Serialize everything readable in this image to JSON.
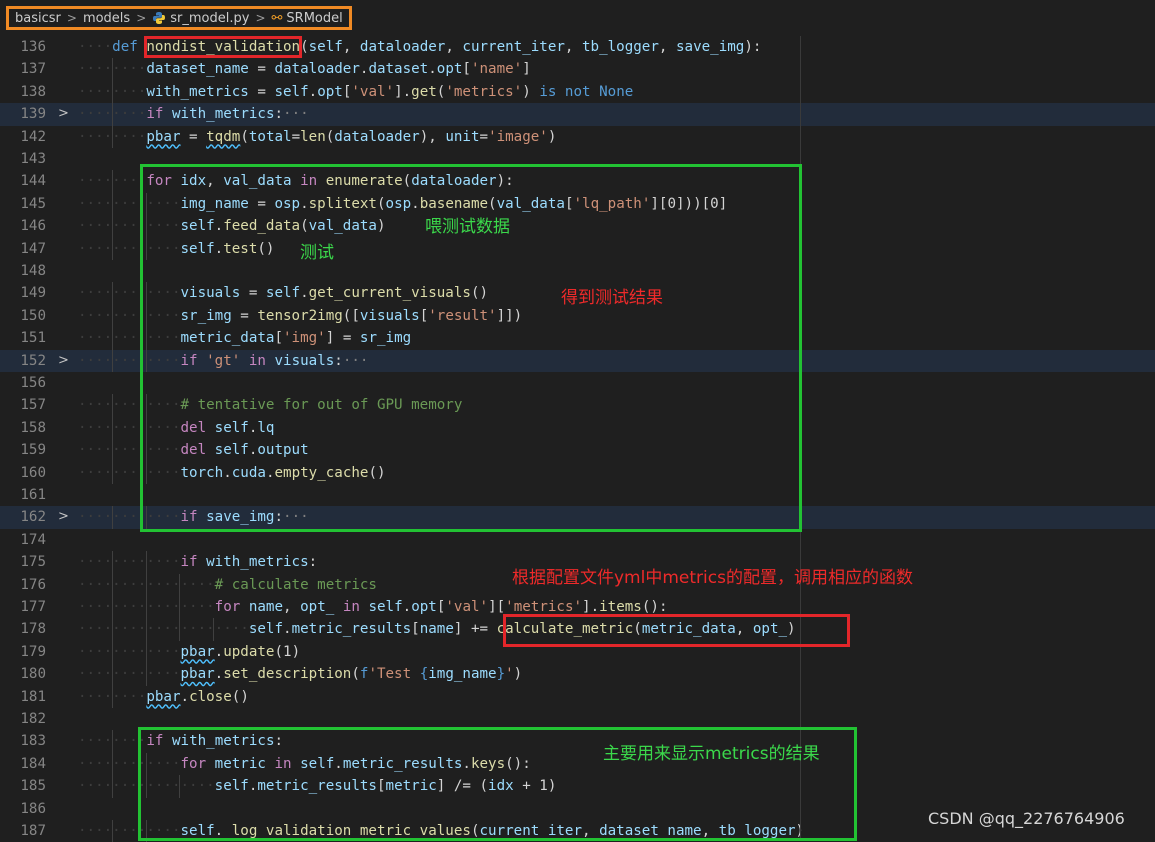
{
  "breadcrumb": {
    "items": [
      "basicsr",
      "models",
      "sr_model.py",
      "SRModel"
    ],
    "separator": ">"
  },
  "lines": [
    {
      "n": "136",
      "fold": false,
      "hl": false
    },
    {
      "n": "137",
      "fold": false,
      "hl": false
    },
    {
      "n": "138",
      "fold": false,
      "hl": false
    },
    {
      "n": "139",
      "fold": true,
      "hl": true
    },
    {
      "n": "142",
      "fold": false,
      "hl": false
    },
    {
      "n": "143",
      "fold": false,
      "hl": false
    },
    {
      "n": "144",
      "fold": false,
      "hl": false
    },
    {
      "n": "145",
      "fold": false,
      "hl": false
    },
    {
      "n": "146",
      "fold": false,
      "hl": false
    },
    {
      "n": "147",
      "fold": false,
      "hl": false
    },
    {
      "n": "148",
      "fold": false,
      "hl": false
    },
    {
      "n": "149",
      "fold": false,
      "hl": false
    },
    {
      "n": "150",
      "fold": false,
      "hl": false
    },
    {
      "n": "151",
      "fold": false,
      "hl": false
    },
    {
      "n": "152",
      "fold": true,
      "hl": true
    },
    {
      "n": "156",
      "fold": false,
      "hl": false
    },
    {
      "n": "157",
      "fold": false,
      "hl": false
    },
    {
      "n": "158",
      "fold": false,
      "hl": false
    },
    {
      "n": "159",
      "fold": false,
      "hl": false
    },
    {
      "n": "160",
      "fold": false,
      "hl": false
    },
    {
      "n": "161",
      "fold": false,
      "hl": false
    },
    {
      "n": "162",
      "fold": true,
      "hl": true
    },
    {
      "n": "174",
      "fold": false,
      "hl": false
    },
    {
      "n": "175",
      "fold": false,
      "hl": false
    },
    {
      "n": "176",
      "fold": false,
      "hl": false
    },
    {
      "n": "177",
      "fold": false,
      "hl": false
    },
    {
      "n": "178",
      "fold": false,
      "hl": false
    },
    {
      "n": "179",
      "fold": false,
      "hl": false
    },
    {
      "n": "180",
      "fold": false,
      "hl": false
    },
    {
      "n": "181",
      "fold": false,
      "hl": false
    },
    {
      "n": "182",
      "fold": false,
      "hl": false
    },
    {
      "n": "183",
      "fold": false,
      "hl": false
    },
    {
      "n": "184",
      "fold": false,
      "hl": false
    },
    {
      "n": "185",
      "fold": false,
      "hl": false
    },
    {
      "n": "186",
      "fold": false,
      "hl": false
    },
    {
      "n": "187",
      "fold": false,
      "hl": false
    }
  ],
  "code": [
    [
      [
        1,
        ""
      ],
      [
        "kw",
        "def"
      ],
      [
        "txt",
        " "
      ],
      [
        "fn",
        "nondist_validation"
      ],
      [
        "txt",
        "("
      ],
      [
        "var",
        "self"
      ],
      [
        "txt",
        ", "
      ],
      [
        "var",
        "dataloader"
      ],
      [
        "txt",
        ", "
      ],
      [
        "var",
        "current_iter"
      ],
      [
        "txt",
        ", "
      ],
      [
        "var",
        "tb_logger"
      ],
      [
        "txt",
        ", "
      ],
      [
        "var",
        "save_img"
      ],
      [
        "txt",
        "):"
      ]
    ],
    [
      [
        2,
        ""
      ],
      [
        "var",
        "dataset_name"
      ],
      [
        "txt",
        " = "
      ],
      [
        "var",
        "dataloader"
      ],
      [
        "txt",
        "."
      ],
      [
        "var",
        "dataset"
      ],
      [
        "txt",
        "."
      ],
      [
        "var",
        "opt"
      ],
      [
        "txt",
        "["
      ],
      [
        "str",
        "'name'"
      ],
      [
        "txt",
        "]"
      ]
    ],
    [
      [
        2,
        ""
      ],
      [
        "var",
        "with_metrics"
      ],
      [
        "txt",
        " = "
      ],
      [
        "var",
        "self"
      ],
      [
        "txt",
        "."
      ],
      [
        "var",
        "opt"
      ],
      [
        "txt",
        "["
      ],
      [
        "str",
        "'val'"
      ],
      [
        "txt",
        "]."
      ],
      [
        "fn",
        "get"
      ],
      [
        "txt",
        "("
      ],
      [
        "str",
        "'metrics'"
      ],
      [
        "txt",
        ") "
      ],
      [
        "kw",
        "is not"
      ],
      [
        "txt",
        " "
      ],
      [
        "kw",
        "None"
      ]
    ],
    [
      [
        2,
        ""
      ],
      [
        "kc",
        "if"
      ],
      [
        "txt",
        " "
      ],
      [
        "var",
        "with_metrics"
      ],
      [
        "txt",
        ":"
      ],
      [
        "fold-ell",
        "···"
      ]
    ],
    [
      [
        2,
        ""
      ],
      [
        "var squig",
        "pbar"
      ],
      [
        "txt",
        " = "
      ],
      [
        "fn squig",
        "tqdm"
      ],
      [
        "txt",
        "("
      ],
      [
        "var",
        "total"
      ],
      [
        "txt",
        "="
      ],
      [
        "fn",
        "len"
      ],
      [
        "txt",
        "("
      ],
      [
        "var",
        "dataloader"
      ],
      [
        "txt",
        "), "
      ],
      [
        "var",
        "unit"
      ],
      [
        "txt",
        "="
      ],
      [
        "str",
        "'image'"
      ],
      [
        "txt",
        ")"
      ]
    ],
    [
      [
        0,
        ""
      ]
    ],
    [
      [
        2,
        ""
      ],
      [
        "kc",
        "for"
      ],
      [
        "txt",
        " "
      ],
      [
        "var",
        "idx"
      ],
      [
        "txt",
        ", "
      ],
      [
        "var",
        "val_data"
      ],
      [
        "txt",
        " "
      ],
      [
        "kc",
        "in"
      ],
      [
        "txt",
        " "
      ],
      [
        "fn",
        "enumerate"
      ],
      [
        "txt",
        "("
      ],
      [
        "var",
        "dataloader"
      ],
      [
        "txt",
        "):"
      ]
    ],
    [
      [
        3,
        ""
      ],
      [
        "var",
        "img_name"
      ],
      [
        "txt",
        " = "
      ],
      [
        "var",
        "osp"
      ],
      [
        "txt",
        "."
      ],
      [
        "fn",
        "splitext"
      ],
      [
        "txt",
        "("
      ],
      [
        "var",
        "osp"
      ],
      [
        "txt",
        "."
      ],
      [
        "fn",
        "basename"
      ],
      [
        "txt",
        "("
      ],
      [
        "var",
        "val_data"
      ],
      [
        "txt",
        "["
      ],
      [
        "str",
        "'lq_path'"
      ],
      [
        "txt",
        "]["
      ],
      [
        "txt",
        "0"
      ],
      [
        "txt",
        "]))["
      ],
      [
        "txt",
        "0"
      ],
      [
        "txt",
        "]"
      ]
    ],
    [
      [
        3,
        ""
      ],
      [
        "var",
        "self"
      ],
      [
        "txt",
        "."
      ],
      [
        "fn",
        "feed_data"
      ],
      [
        "txt",
        "("
      ],
      [
        "var",
        "val_data"
      ],
      [
        "txt",
        ")"
      ]
    ],
    [
      [
        3,
        ""
      ],
      [
        "var",
        "self"
      ],
      [
        "txt",
        "."
      ],
      [
        "fn",
        "test"
      ],
      [
        "txt",
        "()"
      ]
    ],
    [
      [
        0,
        ""
      ]
    ],
    [
      [
        3,
        ""
      ],
      [
        "var",
        "visuals"
      ],
      [
        "txt",
        " = "
      ],
      [
        "var",
        "self"
      ],
      [
        "txt",
        "."
      ],
      [
        "fn",
        "get_current_visuals"
      ],
      [
        "txt",
        "()"
      ]
    ],
    [
      [
        3,
        ""
      ],
      [
        "var",
        "sr_img"
      ],
      [
        "txt",
        " = "
      ],
      [
        "fn",
        "tensor2img"
      ],
      [
        "txt",
        "(["
      ],
      [
        "var",
        "visuals"
      ],
      [
        "txt",
        "["
      ],
      [
        "str",
        "'result'"
      ],
      [
        "txt",
        "]])"
      ]
    ],
    [
      [
        3,
        ""
      ],
      [
        "var",
        "metric_data"
      ],
      [
        "txt",
        "["
      ],
      [
        "str",
        "'img'"
      ],
      [
        "txt",
        "] = "
      ],
      [
        "var",
        "sr_img"
      ]
    ],
    [
      [
        3,
        ""
      ],
      [
        "kc",
        "if"
      ],
      [
        "txt",
        " "
      ],
      [
        "str",
        "'gt'"
      ],
      [
        "txt",
        " "
      ],
      [
        "kc",
        "in"
      ],
      [
        "txt",
        " "
      ],
      [
        "var",
        "visuals"
      ],
      [
        "txt",
        ":"
      ],
      [
        "fold-ell",
        "···"
      ]
    ],
    [
      [
        0,
        ""
      ]
    ],
    [
      [
        3,
        ""
      ],
      [
        "cm",
        "# tentative for out of GPU memory"
      ]
    ],
    [
      [
        3,
        ""
      ],
      [
        "kc",
        "del"
      ],
      [
        "txt",
        " "
      ],
      [
        "var",
        "self"
      ],
      [
        "txt",
        "."
      ],
      [
        "var",
        "lq"
      ]
    ],
    [
      [
        3,
        ""
      ],
      [
        "kc",
        "del"
      ],
      [
        "txt",
        " "
      ],
      [
        "var",
        "self"
      ],
      [
        "txt",
        "."
      ],
      [
        "var",
        "output"
      ]
    ],
    [
      [
        3,
        ""
      ],
      [
        "var",
        "torch"
      ],
      [
        "txt",
        "."
      ],
      [
        "var",
        "cuda"
      ],
      [
        "txt",
        "."
      ],
      [
        "fn",
        "empty_cache"
      ],
      [
        "txt",
        "()"
      ]
    ],
    [
      [
        0,
        ""
      ]
    ],
    [
      [
        3,
        ""
      ],
      [
        "kc",
        "if"
      ],
      [
        "txt",
        " "
      ],
      [
        "var",
        "save_img"
      ],
      [
        "txt",
        ":"
      ],
      [
        "fold-ell",
        "···"
      ]
    ],
    [
      [
        0,
        ""
      ]
    ],
    [
      [
        3,
        ""
      ],
      [
        "kc",
        "if"
      ],
      [
        "txt",
        " "
      ],
      [
        "var",
        "with_metrics"
      ],
      [
        "txt",
        ":"
      ]
    ],
    [
      [
        4,
        ""
      ],
      [
        "cm",
        "# calculate metrics"
      ]
    ],
    [
      [
        4,
        ""
      ],
      [
        "kc",
        "for"
      ],
      [
        "txt",
        " "
      ],
      [
        "var",
        "name"
      ],
      [
        "txt",
        ", "
      ],
      [
        "var",
        "opt_"
      ],
      [
        "txt",
        " "
      ],
      [
        "kc",
        "in"
      ],
      [
        "txt",
        " "
      ],
      [
        "var",
        "self"
      ],
      [
        "txt",
        "."
      ],
      [
        "var",
        "opt"
      ],
      [
        "txt",
        "["
      ],
      [
        "str",
        "'val'"
      ],
      [
        "txt",
        "]["
      ],
      [
        "str",
        "'metrics'"
      ],
      [
        "txt",
        "]."
      ],
      [
        "fn",
        "items"
      ],
      [
        "txt",
        "():"
      ]
    ],
    [
      [
        5,
        ""
      ],
      [
        "var",
        "self"
      ],
      [
        "txt",
        "."
      ],
      [
        "var",
        "metric_results"
      ],
      [
        "txt",
        "["
      ],
      [
        "var",
        "name"
      ],
      [
        "txt",
        "] += "
      ],
      [
        "fn",
        "calculate_metric"
      ],
      [
        "txt",
        "("
      ],
      [
        "var",
        "metric_data"
      ],
      [
        "txt",
        ", "
      ],
      [
        "var",
        "opt_"
      ],
      [
        "txt",
        ")"
      ]
    ],
    [
      [
        3,
        ""
      ],
      [
        "var squig",
        "pbar"
      ],
      [
        "txt",
        "."
      ],
      [
        "fn",
        "update"
      ],
      [
        "txt",
        "("
      ],
      [
        "txt",
        "1"
      ],
      [
        "txt",
        ")"
      ]
    ],
    [
      [
        3,
        ""
      ],
      [
        "var squig",
        "pbar"
      ],
      [
        "txt",
        "."
      ],
      [
        "fn",
        "set_description"
      ],
      [
        "txt",
        "("
      ],
      [
        "kw",
        "f"
      ],
      [
        "str",
        "'Test "
      ],
      [
        "kw",
        "{"
      ],
      [
        "var",
        "img_name"
      ],
      [
        "kw",
        "}"
      ],
      [
        "str",
        "'"
      ],
      [
        "txt",
        ")"
      ]
    ],
    [
      [
        2,
        ""
      ],
      [
        "var squig",
        "pbar"
      ],
      [
        "txt",
        "."
      ],
      [
        "fn",
        "close"
      ],
      [
        "txt",
        "()"
      ]
    ],
    [
      [
        0,
        ""
      ]
    ],
    [
      [
        2,
        ""
      ],
      [
        "kc",
        "if"
      ],
      [
        "txt",
        " "
      ],
      [
        "var",
        "with_metrics"
      ],
      [
        "txt",
        ":"
      ]
    ],
    [
      [
        3,
        ""
      ],
      [
        "kc",
        "for"
      ],
      [
        "txt",
        " "
      ],
      [
        "var",
        "metric"
      ],
      [
        "txt",
        " "
      ],
      [
        "kc",
        "in"
      ],
      [
        "txt",
        " "
      ],
      [
        "var",
        "self"
      ],
      [
        "txt",
        "."
      ],
      [
        "var",
        "metric_results"
      ],
      [
        "txt",
        "."
      ],
      [
        "fn",
        "keys"
      ],
      [
        "txt",
        "():"
      ]
    ],
    [
      [
        4,
        ""
      ],
      [
        "var",
        "self"
      ],
      [
        "txt",
        "."
      ],
      [
        "var",
        "metric_results"
      ],
      [
        "txt",
        "["
      ],
      [
        "var",
        "metric"
      ],
      [
        "txt",
        "] /= ("
      ],
      [
        "var",
        "idx"
      ],
      [
        "txt",
        " + "
      ],
      [
        "txt",
        "1"
      ],
      [
        "txt",
        ")"
      ]
    ],
    [
      [
        0,
        ""
      ]
    ],
    [
      [
        3,
        ""
      ],
      [
        "var",
        "self"
      ],
      [
        "txt",
        "."
      ],
      [
        "fn",
        "_log_validation_metric_values"
      ],
      [
        "txt",
        "("
      ],
      [
        "var",
        "current_iter"
      ],
      [
        "txt",
        ", "
      ],
      [
        "var",
        "dataset_name"
      ],
      [
        "txt",
        ", "
      ],
      [
        "var",
        "tb_logger"
      ],
      [
        "txt",
        ")"
      ]
    ]
  ],
  "annotations": {
    "feed": "喂测试数据",
    "test": "测试",
    "result": "得到测试结果",
    "config": "根据配置文件yml中metrics的配置，调用相应的函数",
    "display": "主要用来显示metrics的结果"
  },
  "watermark": "CSDN @qq_2276764906",
  "colors": {
    "background": "#1f1f1f",
    "red_box": "#e3262a",
    "green_box": "#22c233",
    "breadcrumb_box": "#f08a24"
  }
}
